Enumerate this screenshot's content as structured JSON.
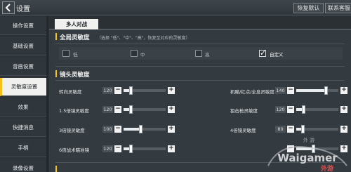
{
  "header": {
    "title": "设置",
    "restore_label": "恢复默认",
    "contact_label": "联系客服"
  },
  "sidebar": {
    "items": [
      {
        "label": "操作设置",
        "active": false
      },
      {
        "label": "基础设置",
        "active": false
      },
      {
        "label": "音画设置",
        "active": false
      },
      {
        "label": "灵敏度设置",
        "active": true
      },
      {
        "label": "效果",
        "active": false
      },
      {
        "label": "快捷消息",
        "active": false
      },
      {
        "label": "手柄",
        "active": false
      },
      {
        "label": "录像设置",
        "active": false
      }
    ]
  },
  "tabs": [
    {
      "label": "多人对战",
      "active": true
    }
  ],
  "global_section": {
    "title": "全局灵敏度",
    "note": "（选择 \"低\"、\"中\"、\"高\"，恢复至对应的灵敏度）",
    "options": [
      {
        "label": "低",
        "checked": false
      },
      {
        "label": "中",
        "checked": false
      },
      {
        "label": "高",
        "checked": false
      },
      {
        "label": "自定义",
        "checked": true
      }
    ]
  },
  "scope_section": {
    "title": "镜头灵敏度",
    "left_rows": [
      {
        "label": "转向灵敏度",
        "value": "120",
        "level": 0.17
      },
      {
        "label": "1.5倍镜灵敏度",
        "value": "120",
        "level": 0.17
      },
      {
        "label": "3倍镜灵敏度",
        "value": "100",
        "level": 0.4
      },
      {
        "label": "6倍战术瞄准镜",
        "value": "120",
        "level": 0.17
      }
    ],
    "right_rows": [
      {
        "label": "机瞄/红点/全息灵敏度",
        "value": "140",
        "level": 0.7
      },
      {
        "label": "狙击枪灵敏度",
        "value": "120",
        "level": 0.17
      },
      {
        "label": "4倍镜灵敏度",
        "value": "80",
        "level": 0.15
      },
      {
        "label": "",
        "value": "",
        "level": 0.4
      }
    ]
  },
  "stepper": {
    "minus": "−",
    "plus": "+"
  },
  "watermark": {
    "brand": "Waigamer",
    "sub": "外游"
  },
  "colors": {
    "accent": "#f5c21c",
    "active_tab_bg": "#f0f0ee",
    "panel_bg": "#343b40"
  }
}
